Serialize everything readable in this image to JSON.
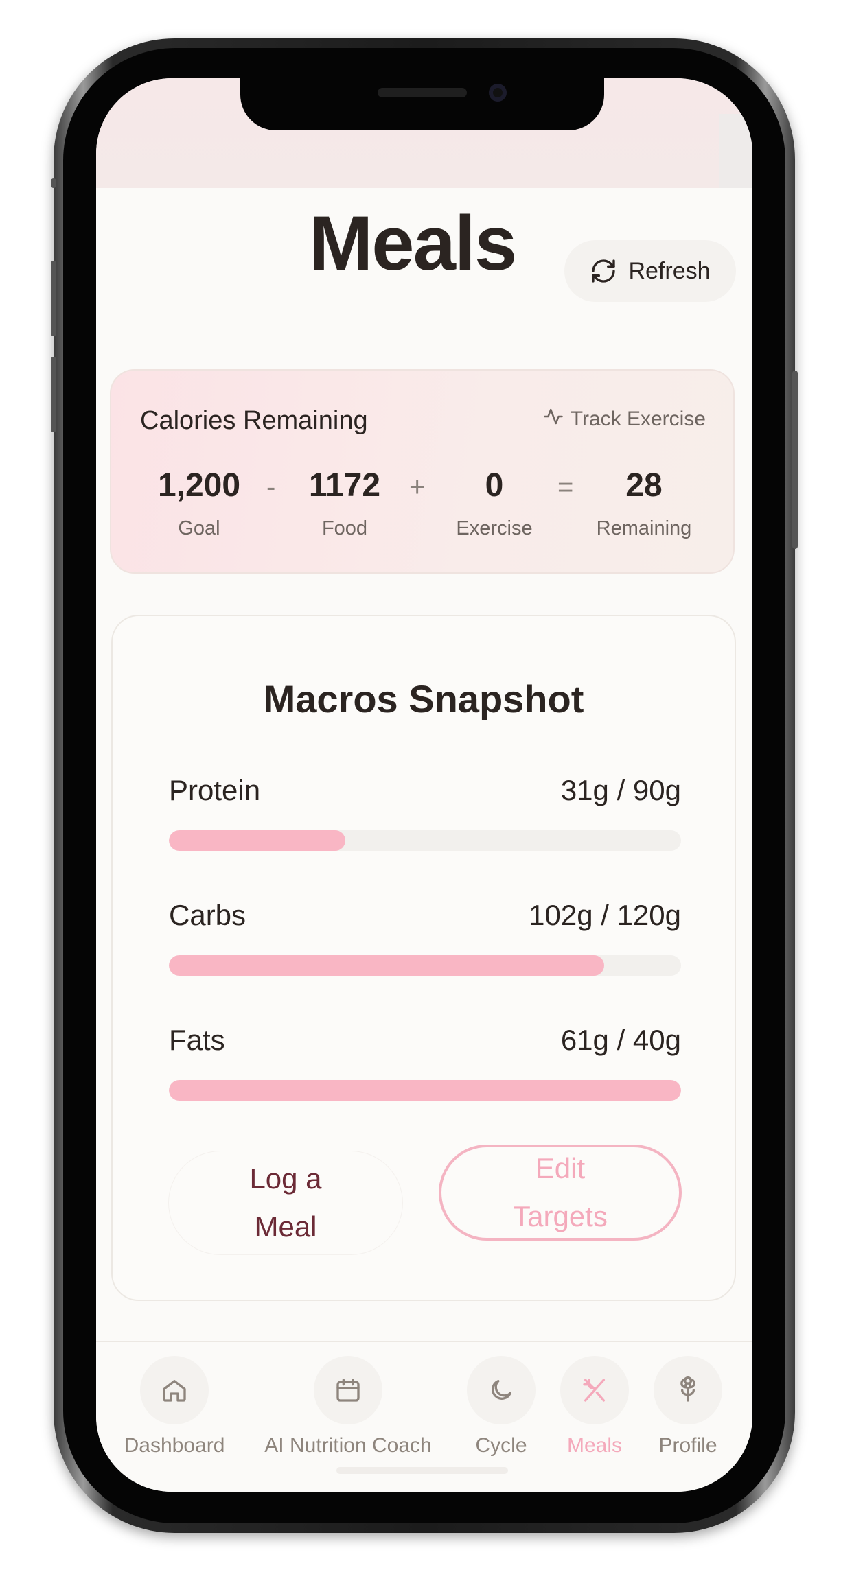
{
  "header": {
    "title": "Meals",
    "refresh_label": "Refresh"
  },
  "calories": {
    "title": "Calories Remaining",
    "track_exercise_label": "Track Exercise",
    "goal": {
      "value": "1,200",
      "label": "Goal"
    },
    "food": {
      "value": "1172",
      "label": "Food"
    },
    "exercise": {
      "value": "0",
      "label": "Exercise"
    },
    "remaining": {
      "value": "28",
      "label": "Remaining"
    },
    "operators": {
      "minus": "-",
      "plus": "+",
      "equals": "="
    }
  },
  "macros": {
    "title": "Macros Snapshot",
    "items": [
      {
        "name": "Protein",
        "value": "31g / 90g",
        "progress": 0.344
      },
      {
        "name": "Carbs",
        "value": "102g / 120g",
        "progress": 0.85
      },
      {
        "name": "Fats",
        "value": "61g / 40g",
        "progress": 1.0
      }
    ],
    "log_meal_line1": "Log a",
    "log_meal_line2": "Meal",
    "edit_targets_line1": "Edit",
    "edit_targets_line2": "Targets"
  },
  "nav": {
    "items": [
      {
        "label": "Dashboard",
        "icon": "home-icon",
        "active": false
      },
      {
        "label": "AI Nutrition Coach",
        "icon": "calendar-icon",
        "active": false
      },
      {
        "label": "Cycle",
        "icon": "moon-icon",
        "active": false
      },
      {
        "label": "Meals",
        "icon": "utensils-icon",
        "active": true
      },
      {
        "label": "Profile",
        "icon": "flower-icon",
        "active": false
      }
    ]
  },
  "colors": {
    "accent_pink": "#f9b6c4",
    "text_dark": "#2b2421",
    "text_muted": "#6e6560",
    "button_text_maroon": "#6b2a36"
  }
}
